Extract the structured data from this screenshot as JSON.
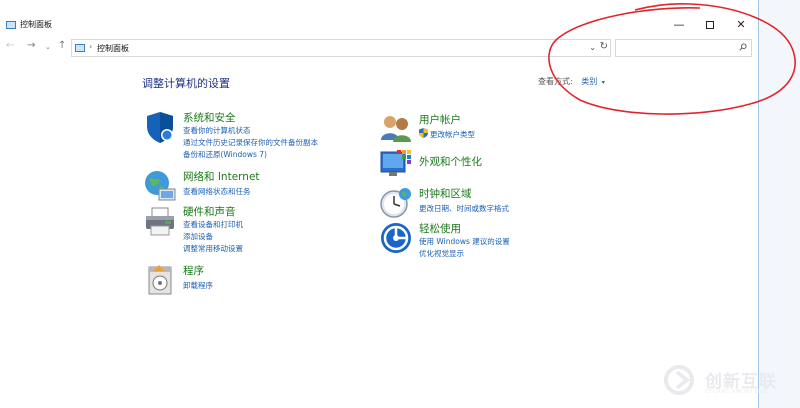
{
  "window": {
    "title": "控制面板",
    "minimize_glyph": "—",
    "close_glyph": "✕"
  },
  "nav": {
    "back_glyph": "←",
    "forward_glyph": "→",
    "recent_glyph": "⌄",
    "up_glyph": "↑"
  },
  "address": {
    "separator": "›",
    "crumb": "控制面板",
    "dropdown_glyph": "⌄",
    "refresh_glyph": "↻"
  },
  "search": {
    "placeholder": ""
  },
  "main": {
    "heading": "调整计算机的设置",
    "view_by_label": "查看方式:",
    "view_by_value": "类别",
    "view_by_arrow": "▾"
  },
  "categories": [
    {
      "id": "system-security",
      "icon": "shield-icon",
      "title": "系统和安全",
      "links": [
        "查看你的计算机状态",
        "通过文件历史记录保存你的文件备份副本",
        "备份和还原(Windows 7)"
      ]
    },
    {
      "id": "network-internet",
      "icon": "globe-network-icon",
      "title": "网络和 Internet",
      "links": [
        "查看网络状态和任务"
      ]
    },
    {
      "id": "hardware-sound",
      "icon": "printer-icon",
      "title": "硬件和声音",
      "links": [
        "查看设备和打印机",
        "添加设备",
        "调整常用移动设置"
      ]
    },
    {
      "id": "programs",
      "icon": "programs-icon",
      "title": "程序",
      "links": [
        "卸载程序"
      ]
    },
    {
      "id": "user-accounts",
      "icon": "users-icon",
      "title": "用户帐户",
      "links": [
        "更改帐户类型"
      ]
    },
    {
      "id": "appearance",
      "icon": "appearance-icon",
      "title": "外观和个性化",
      "links": []
    },
    {
      "id": "clock-region",
      "icon": "clock-icon",
      "title": "时钟和区域",
      "links": [
        "更改日期、时间或数字格式"
      ]
    },
    {
      "id": "ease-of-access",
      "icon": "ease-of-access-icon",
      "title": "轻松使用",
      "links": [
        "使用 Windows 建议的设置",
        "优化视觉显示"
      ]
    }
  ],
  "watermark": {
    "title": "创新互联",
    "subtitle": "CHUANG XIN HU LIAN"
  },
  "colors": {
    "category_title": "#1a7a1a",
    "link": "#1a5fb4",
    "heading": "#1e3287",
    "annotation": "#e0262c"
  }
}
